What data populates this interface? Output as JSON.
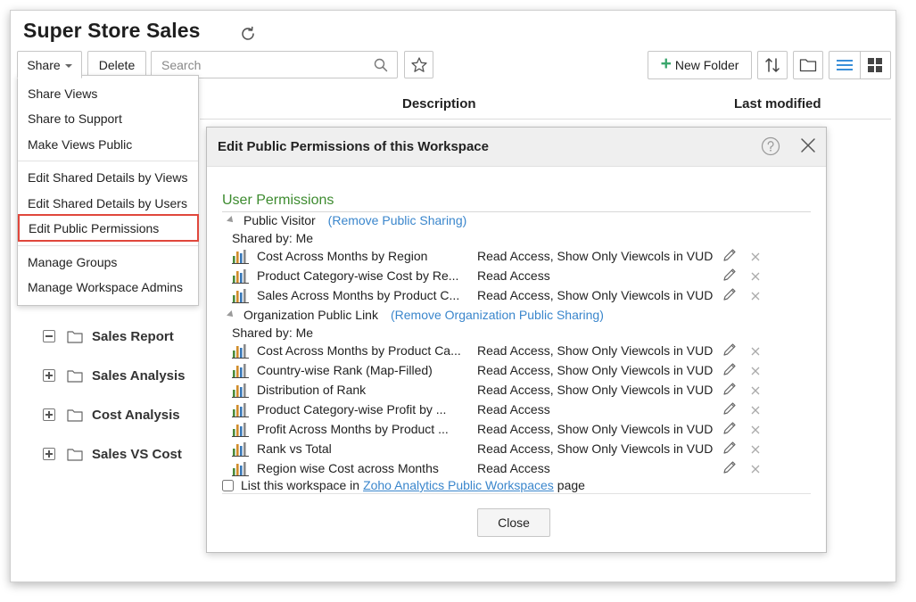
{
  "header": {
    "title": "Super Store Sales",
    "refresh_icon": "refresh-icon"
  },
  "toolbar": {
    "share_label": "Share",
    "delete_label": "Delete",
    "search_placeholder": "Search",
    "new_folder_label": "New Folder"
  },
  "columns": {
    "description": "Description",
    "last_modified": "Last modified"
  },
  "share_menu": {
    "items": [
      "Share Views",
      "Share to Support",
      "Make Views Public",
      "Edit Shared Details by Views",
      "Edit Shared Details by Users",
      "Edit Public Permissions",
      "Manage Groups",
      "Manage Workspace Admins"
    ],
    "highlighted": "Edit Public Permissions"
  },
  "tree": {
    "items": [
      {
        "label": "Sales Report",
        "state": "expanded"
      },
      {
        "label": "Sales Analysis",
        "state": "collapsed"
      },
      {
        "label": "Cost Analysis",
        "state": "collapsed"
      },
      {
        "label": "Sales VS Cost",
        "state": "collapsed"
      }
    ]
  },
  "dialog": {
    "title": "Edit Public Permissions of this Workspace",
    "section_title": "User Permissions",
    "groups": [
      {
        "name": "Public Visitor",
        "remove_link": "(Remove Public Sharing)",
        "shared_by": "Shared by: Me",
        "rows": [
          {
            "view": "Cost Across Months by Region",
            "access": "Read Access, Show Only Viewcols in VUD"
          },
          {
            "view": "Product Category-wise Cost by Re...",
            "access": "Read Access"
          },
          {
            "view": "Sales Across Months by Product C...",
            "access": "Read Access, Show Only Viewcols in VUD"
          }
        ]
      },
      {
        "name": "Organization Public Link",
        "remove_link": "(Remove Organization Public Sharing)",
        "shared_by": "Shared by: Me",
        "rows": [
          {
            "view": "Cost Across Months by Product Ca...",
            "access": "Read Access, Show Only Viewcols in VUD"
          },
          {
            "view": "Country-wise Rank (Map-Filled)",
            "access": "Read Access, Show Only Viewcols in VUD"
          },
          {
            "view": "Distribution of Rank",
            "access": "Read Access, Show Only Viewcols in VUD"
          },
          {
            "view": "Product Category-wise Profit by ...",
            "access": "Read Access"
          },
          {
            "view": "Profit Across Months by Product ...",
            "access": "Read Access, Show Only Viewcols in VUD"
          },
          {
            "view": "Rank vs Total",
            "access": "Read Access, Show Only Viewcols in VUD"
          },
          {
            "view": "Region wise Cost across Months",
            "access": "Read Access"
          }
        ]
      }
    ],
    "list_checkbox": {
      "prefix": "List this workspace in",
      "link": "Zoho Analytics Public Workspaces",
      "suffix": "page",
      "checked": false
    },
    "close_label": "Close"
  },
  "colors": {
    "accent_green": "#3d8b2f",
    "link_blue": "#3a86cc",
    "highlight_red": "#e0473c",
    "active_view_blue": "#3a8fd9"
  }
}
